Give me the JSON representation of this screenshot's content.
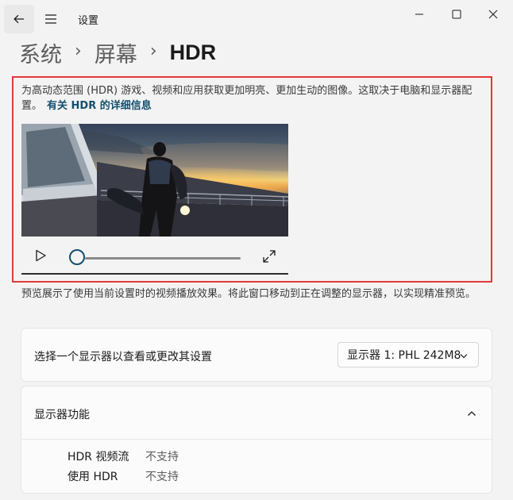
{
  "window": {
    "app_title": "设置"
  },
  "breadcrumb": {
    "items": [
      "系统",
      "屏幕"
    ],
    "current": "HDR",
    "separator": "›"
  },
  "hdr": {
    "description": "为高动态范围 (HDR) 游戏、视频和应用获取更加明亮、更加生动的图像。这取决于电脑和显示器配置。",
    "link_text": "有关 HDR 的详细信息",
    "video_progress": 0
  },
  "preview_note": "预览展示了使用当前设置时的视频播放效果。将此窗口移动到正在调整的显示器，以实现精准预览。",
  "display_select": {
    "label": "选择一个显示器以查看或更改其设置",
    "selected": "显示器 1: PHL 242M8"
  },
  "capabilities": {
    "title": "显示器功能",
    "expanded": true,
    "rows": [
      {
        "name": "HDR 视频流",
        "value": "不支持"
      },
      {
        "name": "使用 HDR",
        "value": "不支持"
      }
    ]
  },
  "colors": {
    "accent": "#134f6e",
    "highlight_border": "#e03a3a",
    "background": "#f3f3f3"
  }
}
